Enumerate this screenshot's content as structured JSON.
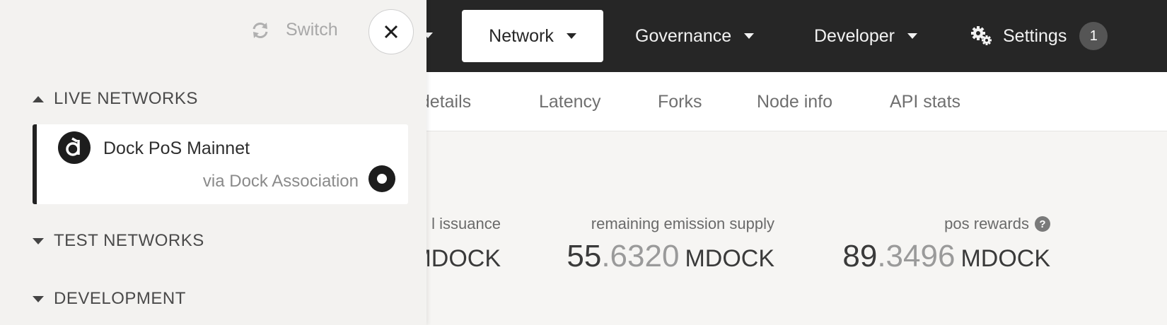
{
  "topnav": {
    "items": [
      {
        "label": "Network"
      },
      {
        "label": "Governance"
      },
      {
        "label": "Developer"
      },
      {
        "label": "Settings",
        "badge": "1"
      }
    ]
  },
  "subnav": {
    "tabs": [
      "t details",
      "Latency",
      "Forks",
      "Node info",
      "API stats"
    ]
  },
  "stats": [
    {
      "label": "l issuance",
      "value_int": "",
      "value_frac": "",
      "unit": "MDOCK"
    },
    {
      "label": "remaining emission supply",
      "value_int": "55",
      "value_frac": ".6320",
      "unit": "MDOCK"
    },
    {
      "label": "pos rewards",
      "value_int": "89",
      "value_frac": ".3496",
      "unit": "MDOCK",
      "help": "?"
    }
  ],
  "panel": {
    "switch_label": "Switch",
    "groups": {
      "live": "LIVE NETWORKS",
      "test": "TEST NETWORKS",
      "dev": "DEVELOPMENT"
    },
    "selected_network": {
      "name": "Dock PoS Mainnet",
      "via": "via Dock Association"
    }
  }
}
